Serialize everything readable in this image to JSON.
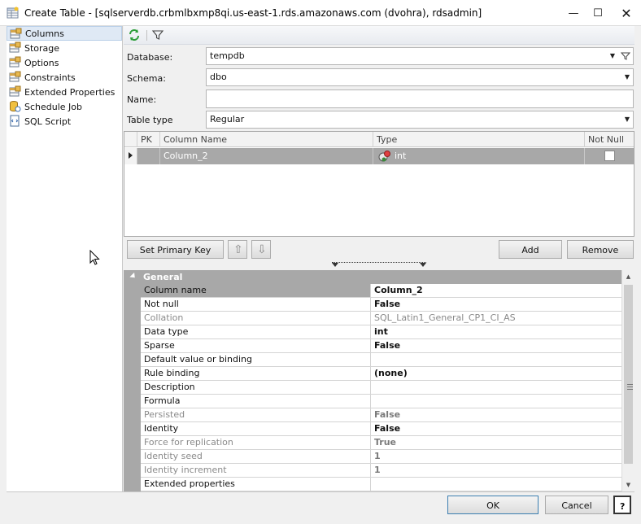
{
  "window": {
    "title": "Create Table - [sqlserverdb.crbmlbxmp8qi.us-east-1.rds.amazonaws.com (dvohra), rdsadmin]",
    "minimize_glyph": "—",
    "maximize_glyph": "☐",
    "close_glyph": "✕"
  },
  "sidebar": {
    "items": [
      {
        "label": "Columns",
        "icon": "table-properties-icon"
      },
      {
        "label": "Storage",
        "icon": "table-properties-icon"
      },
      {
        "label": "Options",
        "icon": "table-properties-icon"
      },
      {
        "label": "Constraints",
        "icon": "table-properties-icon"
      },
      {
        "label": "Extended Properties",
        "icon": "table-properties-icon"
      },
      {
        "label": "Schedule Job",
        "icon": "database-job-icon"
      },
      {
        "label": "SQL Script",
        "icon": "script-icon"
      }
    ]
  },
  "form": {
    "database_label": "Database:",
    "database_value": "tempdb",
    "schema_label": "Schema:",
    "schema_value": "dbo",
    "name_label": "Name:",
    "name_value": "",
    "table_type_label": "Table type",
    "table_type_value": "Regular"
  },
  "grid": {
    "headers": [
      "PK",
      "Column Name",
      "Type",
      "Not Null"
    ],
    "rows": [
      {
        "pk": "",
        "column_name": "Column_2",
        "type": "int",
        "not_null": false
      }
    ]
  },
  "buttons": {
    "set_primary_key": "Set Primary Key",
    "move_up": "⇧",
    "move_down": "⇩",
    "add": "Add",
    "remove": "Remove",
    "ok": "OK",
    "cancel": "Cancel",
    "help": "?"
  },
  "properties": {
    "group": "General",
    "rows": [
      {
        "name": "Column name",
        "value": "Column_2",
        "bold": true,
        "disabled": false
      },
      {
        "name": "Not null",
        "value": "False",
        "bold": true,
        "disabled": false
      },
      {
        "name": "Collation",
        "value": "SQL_Latin1_General_CP1_CI_AS",
        "bold": false,
        "disabled": true
      },
      {
        "name": "Data type",
        "value": "int",
        "bold": true,
        "disabled": false
      },
      {
        "name": "Sparse",
        "value": "False",
        "bold": true,
        "disabled": false
      },
      {
        "name": "Default value or binding",
        "value": "",
        "bold": false,
        "disabled": false
      },
      {
        "name": "Rule binding",
        "value": "(none)",
        "bold": true,
        "disabled": false
      },
      {
        "name": "Description",
        "value": "",
        "bold": false,
        "disabled": false
      },
      {
        "name": "Formula",
        "value": "",
        "bold": false,
        "disabled": false
      },
      {
        "name": "Persisted",
        "value": "False",
        "bold": true,
        "disabled": true
      },
      {
        "name": "Identity",
        "value": "False",
        "bold": true,
        "disabled": false
      },
      {
        "name": "Force for replication",
        "value": "True",
        "bold": true,
        "disabled": true
      },
      {
        "name": "Identity seed",
        "value": "1",
        "bold": true,
        "disabled": true
      },
      {
        "name": "Identity increment",
        "value": "1",
        "bold": true,
        "disabled": true
      },
      {
        "name": "Extended properties",
        "value": "",
        "bold": false,
        "disabled": false
      }
    ]
  },
  "colors": {
    "selection_gray": "#a8a8a8",
    "sidebar_selected": "#dfe9f5",
    "refresh_green": "#2e9e3a"
  }
}
